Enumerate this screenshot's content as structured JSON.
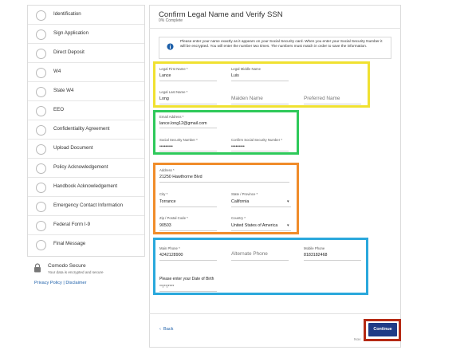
{
  "sidebar": {
    "steps": [
      {
        "label": "Identification"
      },
      {
        "label": "Sign Application"
      },
      {
        "label": "Direct Deposit"
      },
      {
        "label": "W4"
      },
      {
        "label": "State W4"
      },
      {
        "label": "EEO"
      },
      {
        "label": "Confidentiality Agreement"
      },
      {
        "label": "Upload Document"
      },
      {
        "label": "Policy Acknowledgement"
      },
      {
        "label": "Handbook Acknowledgement"
      },
      {
        "label": "Emergency Contact Information"
      },
      {
        "label": "Federal Form I-9"
      },
      {
        "label": "Final Message"
      }
    ],
    "secure_title": "Comodo Secure",
    "secure_sub": "Your data is encrypted and secure",
    "privacy_link": "Privacy Policy",
    "link_separator": " | ",
    "disclaimer_link": "Disclaimer"
  },
  "main": {
    "title": "Confirm Legal Name and Verify SSN",
    "progress_text": "0% Complete",
    "progress": 0,
    "notice": "Please enter your name exactly as it appears on your Social Security card. When you enter your Social Security Number it will be encrypted. You will enter the number two times. The numbers must match in order to save the information."
  },
  "name_section": {
    "first_name_label": "Legal First Name *",
    "first_name_value": "Lance",
    "middle_name_label": "Legal Middle Name",
    "middle_name_value": "Luis",
    "last_name_label": "Legal Last Name *",
    "last_name_value": "Long",
    "maiden_name_placeholder": "Maiden Name",
    "preferred_name_placeholder": "Preferred Name"
  },
  "contact_section": {
    "email_label": "Email Address *",
    "email_value": "lance.long12@gmail.com",
    "ssn_label": "Social Security Number *",
    "ssn_value": "•••••••••",
    "confirm_ssn_label": "Confirm Social Security Number *",
    "confirm_ssn_value": "•••••••••"
  },
  "address_section": {
    "address_label": "Address *",
    "address_value": "21250 Hawthorne Blvd",
    "city_label": "City *",
    "city_value": "Torrance",
    "state_label": "State / Province *",
    "state_value": "California",
    "zip_label": "Zip / Postal Code *",
    "zip_value": "90503",
    "country_label": "Country *",
    "country_value": "United States of America"
  },
  "phone_section": {
    "main_phone_label": "Main Phone *",
    "main_phone_value": "4242128900",
    "alternate_phone_placeholder": "Alternate Phone",
    "mobile_phone_label": "Mobile Phone",
    "mobile_phone_value": "8183182468",
    "dob_label": "Please enter your Date of Birth",
    "dob_value": "**/**/****"
  },
  "footer": {
    "back_label": "Back",
    "continue_label": "Continue",
    "trailing_text": "Nov"
  },
  "highlight_colors": {
    "name": "#f0e130",
    "contact": "#2ec95a",
    "address": "#f08c2a",
    "phone": "#2aa8dc",
    "continue": "#b52a14"
  }
}
